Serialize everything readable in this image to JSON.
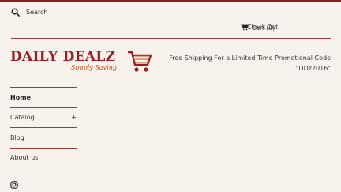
{
  "search": {
    "placeholder": "Search"
  },
  "header": {
    "cart_label": "Cart (0)",
    "checkout_label": "Check Out"
  },
  "logo": {
    "name": "DAILY DEALZ",
    "tagline": "Simply Saving"
  },
  "promo": {
    "line1": "Free Shipping For a Limited Time Promotional Code",
    "line2": "\"DDz2016\""
  },
  "nav": {
    "items": [
      {
        "label": "Home",
        "suffix": ""
      },
      {
        "label": "Catalog",
        "suffix": "+"
      },
      {
        "label": "Blog",
        "suffix": ""
      },
      {
        "label": "About us",
        "suffix": ""
      }
    ]
  },
  "colors": {
    "accent": "#9b1c24",
    "background": "#f7f3ec",
    "tagline": "#c0521f"
  },
  "icons": {
    "search": "search-icon",
    "cart": "cart-icon",
    "social": "instagram-icon"
  }
}
